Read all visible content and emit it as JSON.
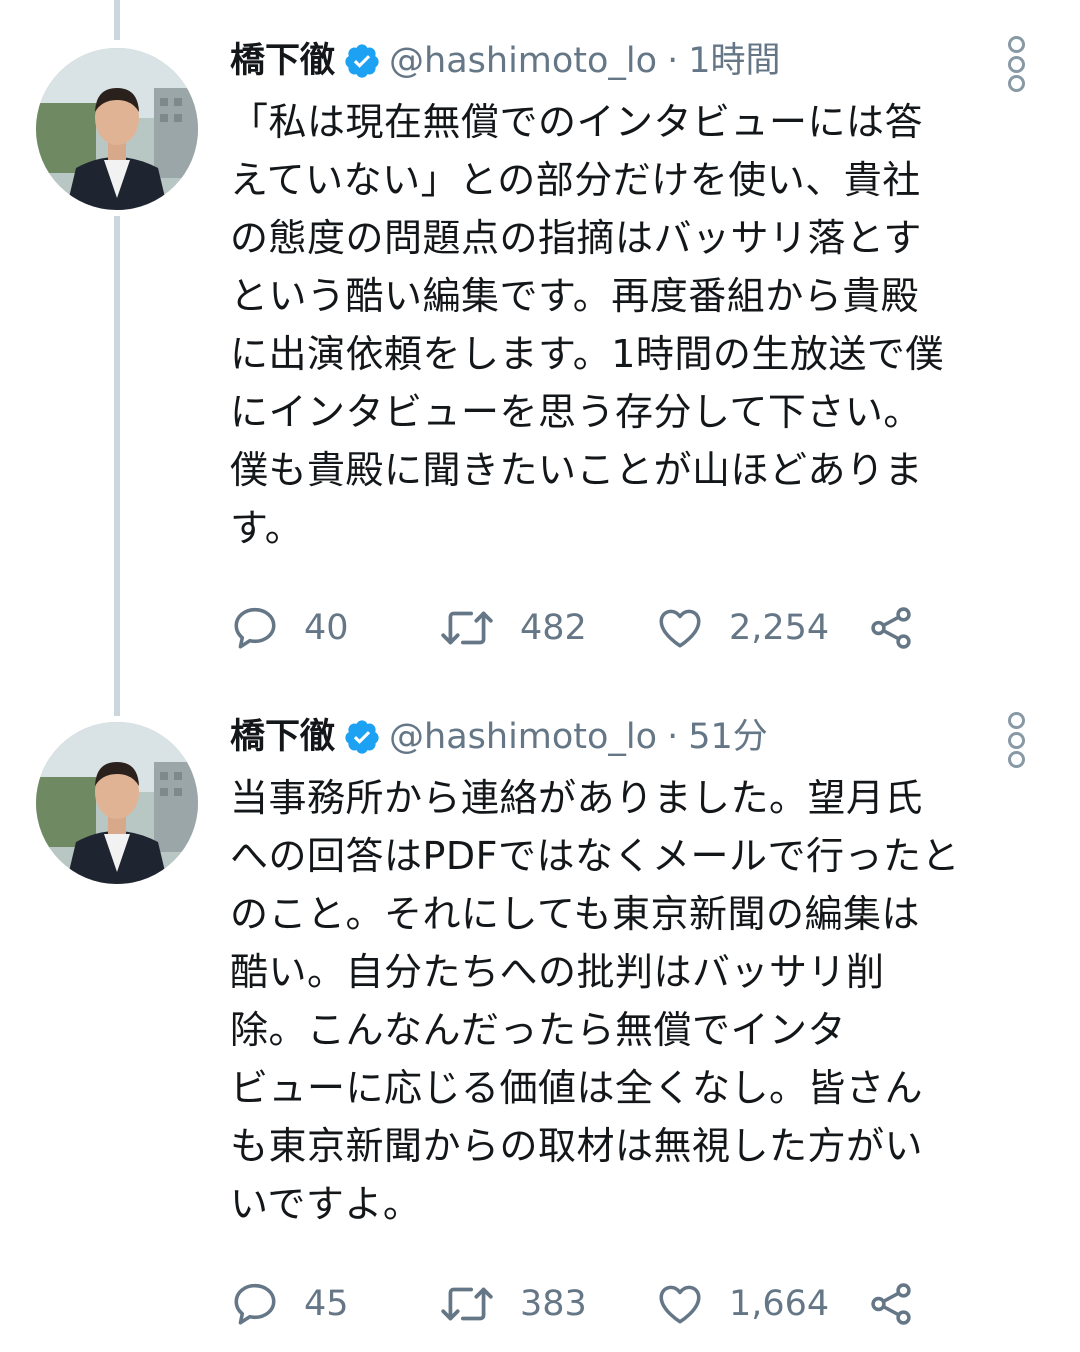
{
  "tweets": [
    {
      "name": "橋下徹",
      "handle": "@hashimoto_lo",
      "dot": "·",
      "time": "1時間",
      "lines": [
        "「私は現在無償でのインタビューには答",
        "えていない」との部分だけを使い、貴社",
        "の態度の問題点の指摘はバッサリ落とす",
        "という酷い編集です。再度番組から貴殿",
        "に出演依頼をします。1時間の生放送で僕",
        "にインタビューを思う存分して下さい。",
        "僕も貴殿に聞きたいことが山ほどありま",
        "す。"
      ],
      "replies": "40",
      "retweets": "482",
      "likes": "2,254"
    },
    {
      "name": "橋下徹",
      "handle": "@hashimoto_lo",
      "dot": "·",
      "time": "51分",
      "lines": [
        "当事務所から連絡がありました。望月氏",
        "への回答はPDFではなくメールで行ったと",
        "のこと。それにしても東京新聞の編集は",
        "酷い。自分たちへの批判はバッサリ削",
        "除。こんなんだったら無償でインタ",
        "ビューに応じる価値は全くなし。皆さん",
        "も東京新聞からの取材は無視した方がい",
        "いですよ。"
      ],
      "replies": "45",
      "retweets": "383",
      "likes": "1,664"
    }
  ],
  "colors": {
    "verified": "#1da1f2",
    "muted": "#657786",
    "thread": "#ccd6dd"
  }
}
